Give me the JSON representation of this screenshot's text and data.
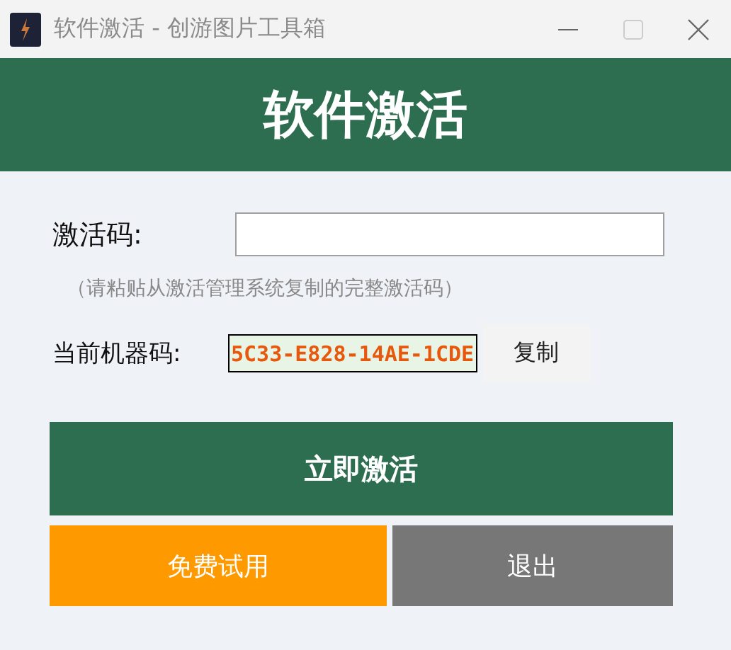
{
  "window": {
    "title": "软件激活 - 创游图片工具箱"
  },
  "header": {
    "title": "软件激活"
  },
  "activation_code": {
    "label": "激活码:",
    "hint": "（请粘贴从激活管理系统复制的完整激活码）"
  },
  "machine_code": {
    "label": "当前机器码:",
    "value": "5C33-E828-14AE-1CDE",
    "copy_button": "复制"
  },
  "buttons": [
    {
      "label": "立即激活",
      "kind": "primary"
    },
    {
      "label": "免费试用",
      "kind": "trial"
    },
    {
      "label": "退出",
      "kind": "exit"
    }
  ]
}
